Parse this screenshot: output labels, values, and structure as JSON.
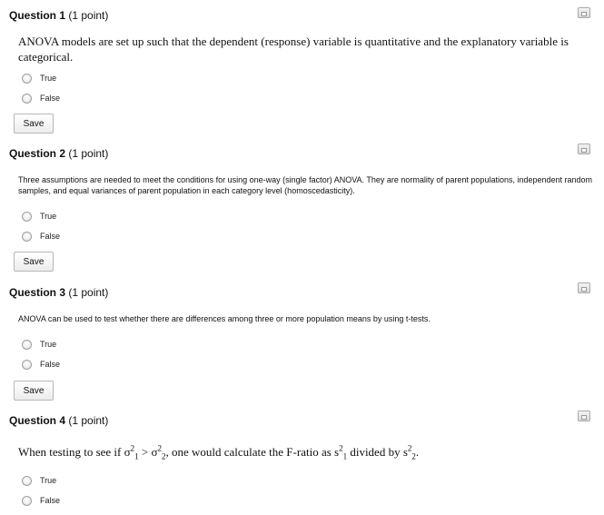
{
  "questions": [
    {
      "title": "Question 1",
      "points": "(1 point)",
      "text": "ANOVA models are set up such that the dependent (response) variable is quantitative and the explanatory variable is categorical.",
      "options": [
        "True",
        "False"
      ],
      "save_label": "Save"
    },
    {
      "title": "Question 2",
      "points": "(1 point)",
      "text": "Three assumptions are needed to meet the conditions for using one-way (single factor) ANOVA. They are normality of parent populations, independent random samples, and equal variances of parent population in each category level (homoscedasticity).",
      "options": [
        "True",
        "False"
      ],
      "save_label": "Save"
    },
    {
      "title": "Question 3",
      "points": "(1 point)",
      "text": "ANOVA can be used to test whether there are differences among three or more population means by using t-tests.",
      "options": [
        "True",
        "False"
      ],
      "save_label": "Save"
    },
    {
      "title": "Question 4",
      "points": "(1 point)",
      "text_parts": {
        "prefix": "When testing to see if σ",
        "exp": "2",
        "sub1": "1",
        "mid": " > σ",
        "sub2": "2",
        "middle": ", one would calculate the F-ratio as s",
        "after": " divided by s",
        "suffix": "."
      },
      "options": [
        "True",
        "False"
      ]
    }
  ]
}
